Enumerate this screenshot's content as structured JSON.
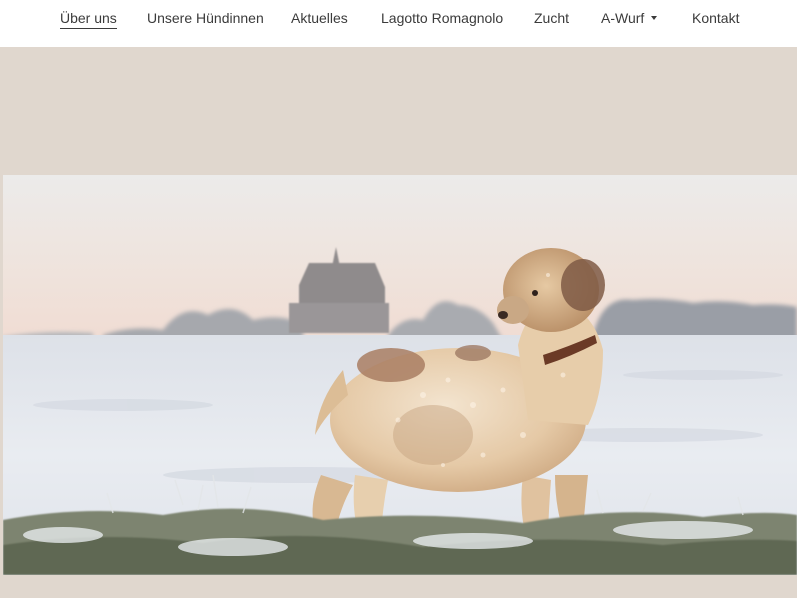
{
  "nav": {
    "items": [
      {
        "label": "Über uns",
        "active": true
      },
      {
        "label": "Unsere Hündinnen"
      },
      {
        "label": "Aktuelles"
      },
      {
        "label": "Lagotto Romagnolo"
      },
      {
        "label": "Zucht"
      },
      {
        "label": "A-Wurf",
        "has_dropdown": true
      },
      {
        "label": "Kontakt"
      }
    ]
  },
  "colors": {
    "page_background": "#e0d7ce",
    "nav_background": "#ffffff",
    "nav_text": "#3b3b3b"
  },
  "hero": {
    "icon": "hero-photo-dog-in-snow"
  }
}
